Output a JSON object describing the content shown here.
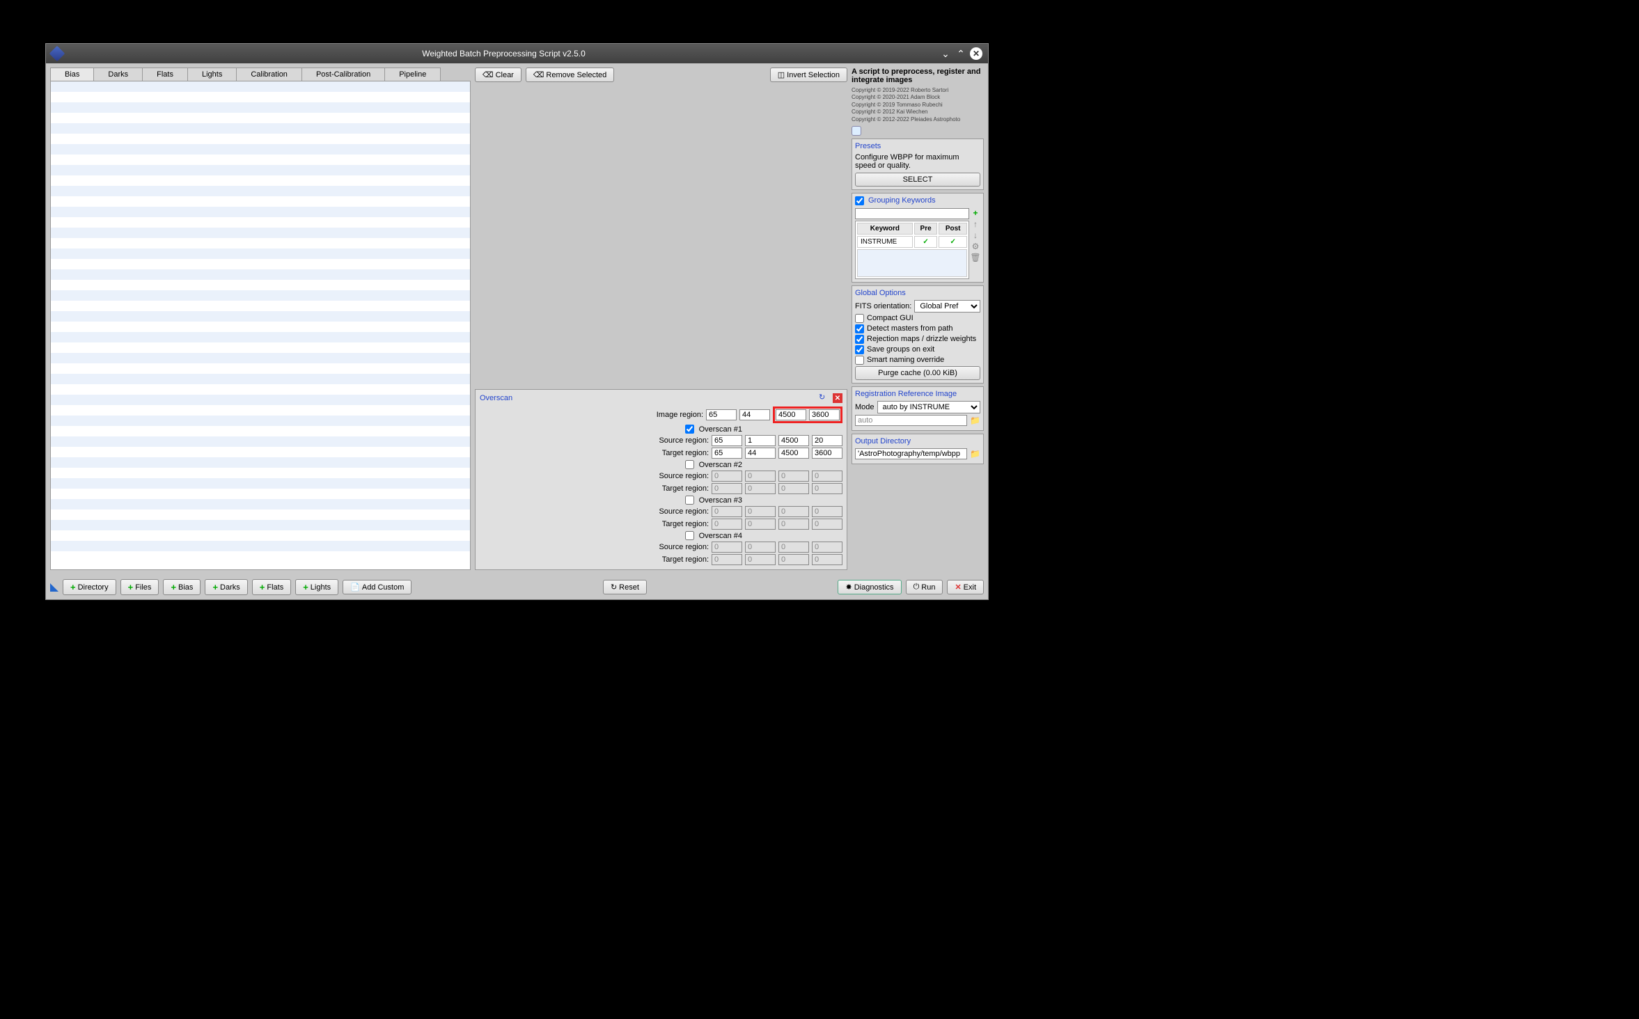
{
  "window_title": "Weighted Batch Preprocessing Script v2.5.0",
  "tabs": [
    "Bias",
    "Darks",
    "Flats",
    "Lights",
    "Calibration",
    "Post-Calibration",
    "Pipeline"
  ],
  "toolbar": {
    "clear": "Clear",
    "remove_selected": "Remove Selected",
    "invert_selection": "Invert Selection"
  },
  "overscan": {
    "title": "Overscan",
    "image_region_label": "Image region:",
    "image_region": [
      "65",
      "44",
      "4500",
      "3600"
    ],
    "sections": [
      {
        "label": "Overscan #1",
        "checked": true,
        "source": [
          "65",
          "1",
          "4500",
          "20"
        ],
        "target": [
          "65",
          "44",
          "4500",
          "3600"
        ],
        "enabled": true
      },
      {
        "label": "Overscan #2",
        "checked": false,
        "source": [
          "0",
          "0",
          "0",
          "0"
        ],
        "target": [
          "0",
          "0",
          "0",
          "0"
        ],
        "enabled": false
      },
      {
        "label": "Overscan #3",
        "checked": false,
        "source": [
          "0",
          "0",
          "0",
          "0"
        ],
        "target": [
          "0",
          "0",
          "0",
          "0"
        ],
        "enabled": false
      },
      {
        "label": "Overscan #4",
        "checked": false,
        "source": [
          "0",
          "0",
          "0",
          "0"
        ],
        "target": [
          "0",
          "0",
          "0",
          "0"
        ],
        "enabled": false
      }
    ],
    "source_label": "Source region:",
    "target_label": "Target region:"
  },
  "right": {
    "description": "A script to preprocess, register and integrate images",
    "copyrights": [
      "Copyright © 2019-2022 Roberto Sartori",
      "Copyright © 2020-2021 Adam Block",
      "Copyright © 2019 Tommaso Rubechi",
      "Copyright © 2012 Kai Wiechen",
      "Copyright © 2012-2022 Pleiades Astrophoto"
    ],
    "presets": {
      "title": "Presets",
      "desc": "Configure WBPP for maximum speed or quality.",
      "select": "SELECT"
    },
    "grouping": {
      "title": "Grouping Keywords",
      "headers": [
        "Keyword",
        "Pre",
        "Post"
      ],
      "row": [
        "INSTRUME",
        "✓",
        "✓"
      ]
    },
    "global": {
      "title": "Global Options",
      "fits_label": "FITS orientation:",
      "fits_value": "Global Pref",
      "opts": [
        {
          "label": "Compact GUI",
          "checked": false
        },
        {
          "label": "Detect masters from path",
          "checked": true
        },
        {
          "label": "Rejection maps / drizzle weights",
          "checked": true
        },
        {
          "label": "Save groups on exit",
          "checked": true
        },
        {
          "label": "Smart naming override",
          "checked": false
        }
      ],
      "purge": "Purge cache (0.00 KiB)"
    },
    "reg": {
      "title": "Registration Reference Image",
      "mode_label": "Mode",
      "mode_value": "auto by INSTRUME",
      "auto_value": "auto"
    },
    "output": {
      "title": "Output Directory",
      "path": "'AstroPhotography/temp/wbpp"
    }
  },
  "bottom": {
    "directory": "Directory",
    "files": "Files",
    "bias": "Bias",
    "darks": "Darks",
    "flats": "Flats",
    "lights": "Lights",
    "add_custom": "Add Custom",
    "reset": "Reset",
    "diagnostics": "Diagnostics",
    "run": "Run",
    "exit": "Exit"
  }
}
